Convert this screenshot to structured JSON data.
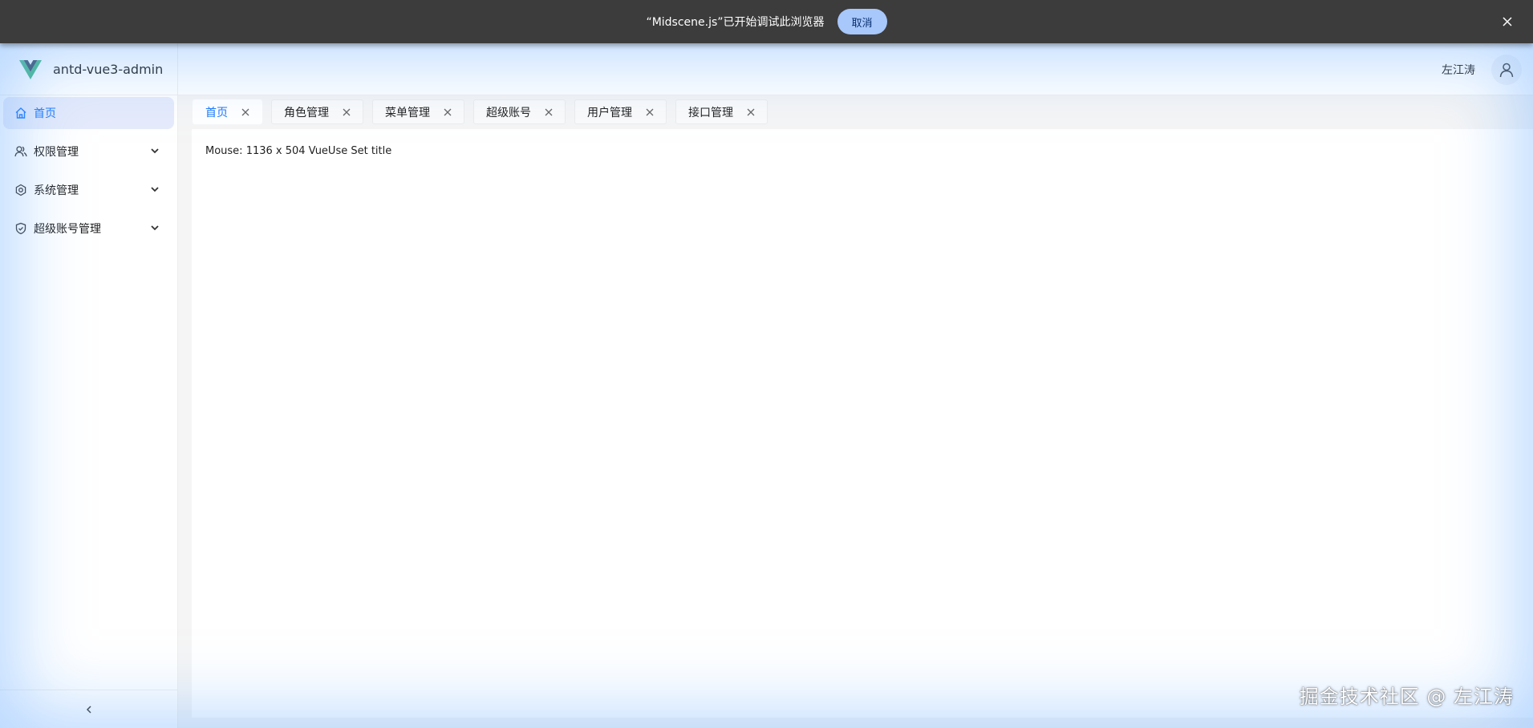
{
  "banner": {
    "message": "“Midscene.js”已开始调试此浏览器",
    "cancel_label": "取消",
    "close_icon": "close-icon"
  },
  "header": {
    "app_name": "antd-vue3-admin",
    "logo_icon": "vue-logo",
    "username": "左江涛",
    "avatar_icon": "user-icon"
  },
  "sidebar": {
    "items": [
      {
        "label": "首页",
        "icon": "home-icon",
        "active": true
      },
      {
        "label": "权限管理",
        "icon": "users-icon",
        "expandable": true
      },
      {
        "label": "系统管理",
        "icon": "gear-icon",
        "expandable": true
      },
      {
        "label": "超级账号管理",
        "icon": "shield-icon",
        "expandable": true
      }
    ],
    "collapse_icon": "chevron-left-icon"
  },
  "tabs": [
    {
      "label": "首页",
      "active": true
    },
    {
      "label": "角色管理"
    },
    {
      "label": "菜单管理"
    },
    {
      "label": "超级账号"
    },
    {
      "label": "用户管理"
    },
    {
      "label": "接口管理"
    }
  ],
  "content": {
    "mouse_text": "Mouse: 1136 x 504 VueUse Set title"
  },
  "watermark": "掘金技术社区 @ 左江涛",
  "colors": {
    "accent": "#1677ff",
    "banner_bg": "#3c3c3c",
    "banner_button": "#a8c7fa",
    "active_menu_bg": "#e6ebfb"
  }
}
